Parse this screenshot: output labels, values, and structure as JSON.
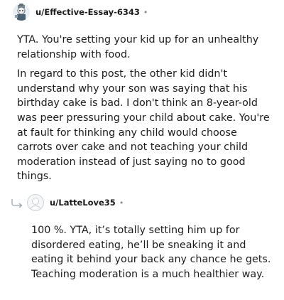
{
  "comments": [
    {
      "username": "u/Effective-Essay-6343",
      "separator": "•",
      "paragraphs": [
        "YTA. You're setting your kid up for an unhealthy relationship with food.",
        "In regard to this post, the other kid didn't understand why your son was saying that his birthday cake is bad. I don't think an 8-year-old was peer pressuring your child about cake. You're at fault for thinking any child would choose carrots over cake and not teaching your child moderation instead of just saying no to good things."
      ]
    },
    {
      "username": "u/LatteLove35",
      "separator": "•",
      "paragraphs": [
        "100 %. YTA, it’s totally setting him up for disordered eating, he’ll be sneaking it and eating it behind your back any chance he gets. Teaching moderation is a much healthier way."
      ]
    }
  ]
}
